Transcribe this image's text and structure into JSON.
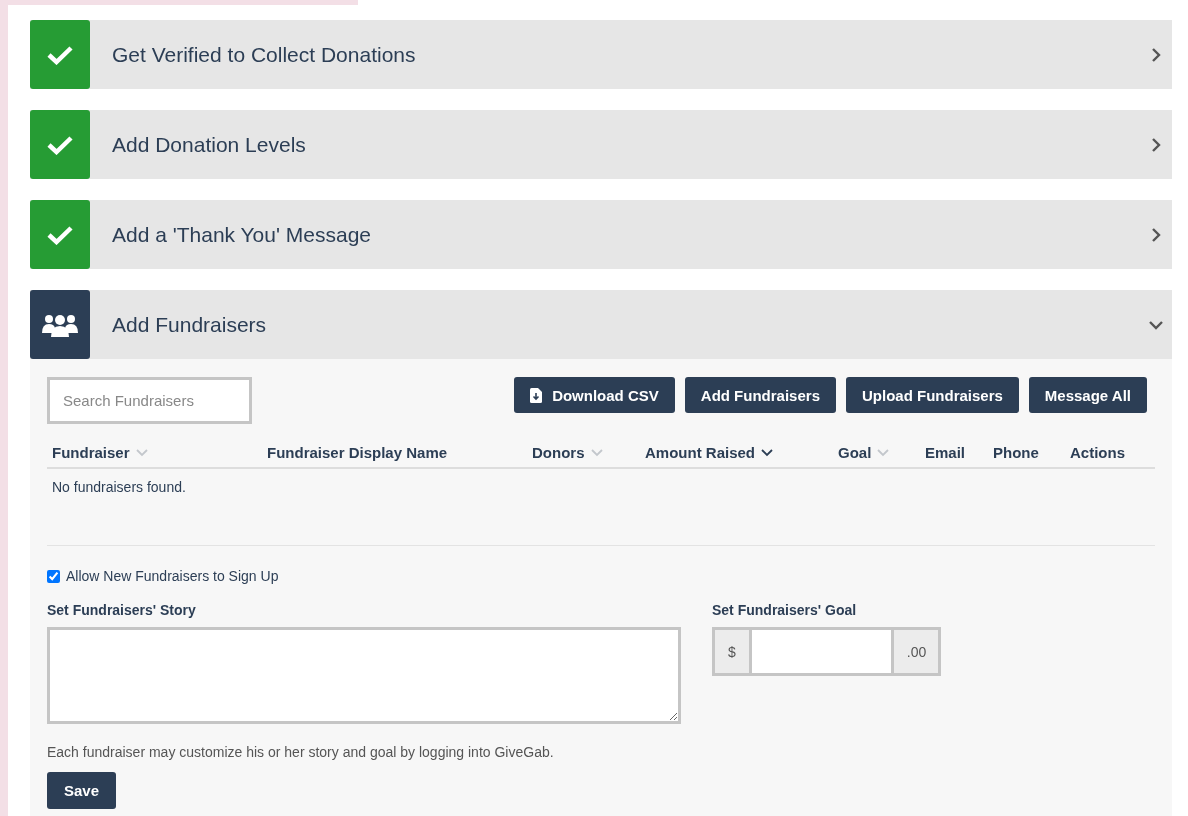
{
  "steps": [
    {
      "title": "Get Verified to Collect Donations",
      "kind": "done",
      "expanded": false
    },
    {
      "title": "Add Donation Levels",
      "kind": "done",
      "expanded": false
    },
    {
      "title": "Add a 'Thank You' Message",
      "kind": "done",
      "expanded": false
    },
    {
      "title": "Add Fundraisers",
      "kind": "people",
      "expanded": true
    }
  ],
  "fundraisers": {
    "search": {
      "placeholder": "Search Fundraisers"
    },
    "buttons": [
      {
        "label": "Download CSV",
        "kind": "download"
      },
      {
        "label": "Add Fundraisers",
        "kind": "plain"
      },
      {
        "label": "Upload Fundraisers",
        "kind": "plain"
      },
      {
        "label": "Message All",
        "kind": "plain"
      }
    ],
    "columns": [
      {
        "label": "Fundraiser",
        "sortable": true,
        "sorted": false
      },
      {
        "label": "Fundraiser Display Name",
        "sortable": false,
        "sorted": false
      },
      {
        "label": "Donors",
        "sortable": true,
        "sorted": false
      },
      {
        "label": "Amount Raised",
        "sortable": true,
        "sorted": true
      },
      {
        "label": "Goal",
        "sortable": true,
        "sorted": false
      },
      {
        "label": "Email",
        "sortable": false,
        "sorted": false
      },
      {
        "label": "Phone",
        "sortable": false,
        "sorted": false
      },
      {
        "label": "Actions",
        "sortable": false,
        "sorted": false
      }
    ],
    "empty_message": "No fundraisers found.",
    "allow_signup": {
      "label": "Allow New Fundraisers to Sign Up",
      "checked": true
    },
    "story": {
      "label": "Set Fundraisers' Story"
    },
    "goal": {
      "label": "Set Fundraisers' Goal",
      "prefix": "$",
      "suffix": ".00"
    },
    "note": "Each fundraiser may customize his or her story and goal by logging into GiveGab.",
    "save": "Save"
  }
}
